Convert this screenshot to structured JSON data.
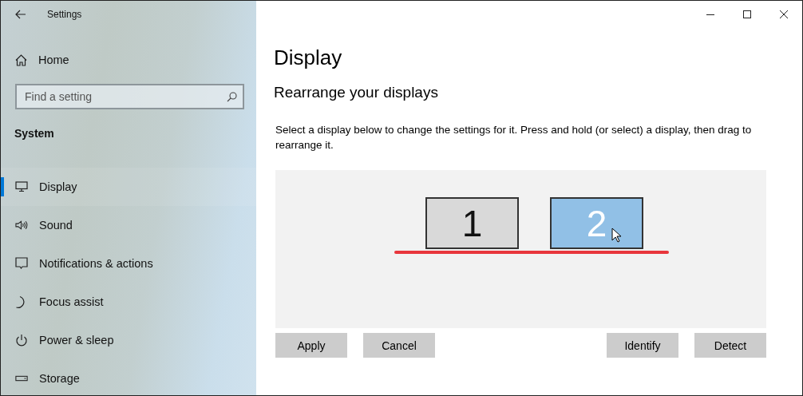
{
  "window": {
    "title": "Settings"
  },
  "sidebar": {
    "home": "Home",
    "search": {
      "placeholder": "Find a setting"
    },
    "section": "System",
    "items": [
      {
        "label": "Display",
        "selected": true
      },
      {
        "label": "Sound",
        "selected": false
      },
      {
        "label": "Notifications & actions",
        "selected": false
      },
      {
        "label": "Focus assist",
        "selected": false
      },
      {
        "label": "Power & sleep",
        "selected": false
      },
      {
        "label": "Storage",
        "selected": false
      }
    ]
  },
  "page": {
    "title": "Display",
    "subtitle": "Rearrange your displays",
    "description": "Select a display below to change the settings for it. Press and hold (or select) a display, then drag to rearrange it.",
    "monitors": [
      {
        "label": "1",
        "selected": false
      },
      {
        "label": "2",
        "selected": true
      }
    ],
    "buttons": [
      "Apply",
      "Cancel",
      "Identify",
      "Detect"
    ]
  }
}
